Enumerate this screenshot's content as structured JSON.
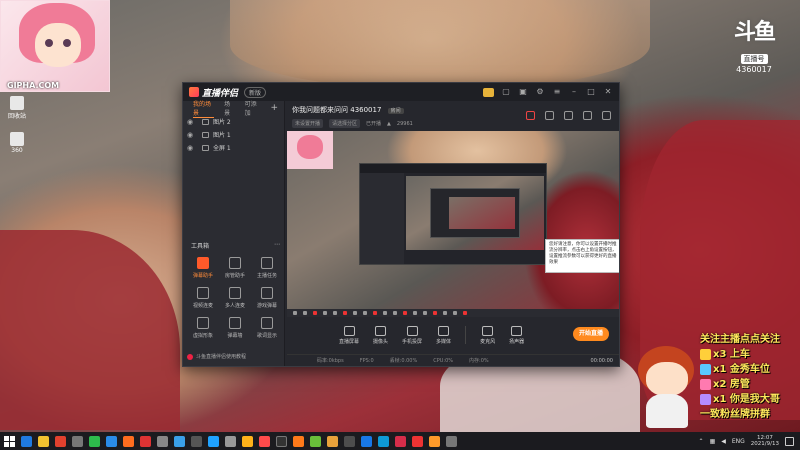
{
  "desktop": {
    "overlay_label": "GIPHA.COM",
    "icons": [
      {
        "label": "回收站"
      },
      {
        "label": "360"
      }
    ]
  },
  "watermark": {
    "logo": "斗鱼",
    "badge": "直播号",
    "room_id": "4360017"
  },
  "app": {
    "brand": "直播伴侣",
    "version": "新版",
    "left_tabs": [
      {
        "label": "我的场景",
        "active": true
      },
      {
        "label": "场景",
        "active": false
      },
      {
        "label": "可添加",
        "active": false
      }
    ],
    "scenes": [
      {
        "label": "图片 2"
      },
      {
        "label": "图片 1"
      },
      {
        "label": "全屏 1"
      }
    ],
    "tools_title": "工具箱",
    "tools": [
      {
        "label": "弹幕助手",
        "hot": true
      },
      {
        "label": "房管助手",
        "hot": false
      },
      {
        "label": "主播任务",
        "hot": false
      },
      {
        "label": "视频连麦",
        "hot": false
      },
      {
        "label": "多人连麦",
        "hot": false
      },
      {
        "label": "游戏弹幕",
        "hot": false
      },
      {
        "label": "虚拟形象",
        "hot": false
      },
      {
        "label": "弹幕墙",
        "hot": false
      },
      {
        "label": "歌词显示",
        "hot": false
      }
    ],
    "footer_text": "斗鱼直播伴侣使用教程",
    "room_title": "你我问题都来问问",
    "room_id": "4360017",
    "room_tag": "房间",
    "room_sub": [
      "未设置开播",
      "请选择分区",
      "已开播"
    ],
    "room_count": "29961",
    "preview_tooltip": "您好请注意，你可以设置开播时推流分辨率，点击右上角设置按钮，设置推流参数可以获得更好的直播效果",
    "bottom_tools": [
      {
        "label": "直播屏幕"
      },
      {
        "label": "摄像头"
      },
      {
        "label": "手机投屏"
      },
      {
        "label": "多媒体"
      },
      {
        "label": "麦克风"
      },
      {
        "label": "扬声器"
      }
    ],
    "go_live": "开始直播",
    "status": [
      "码率:0kbps",
      "FPS:0",
      "丢帧:0.00%",
      "CPU:0%",
      "内存:0%"
    ],
    "status_time": "00:00:00"
  },
  "overlay_list": [
    {
      "text": "关注主播点点关注"
    },
    {
      "text": "x3 上车"
    },
    {
      "text": "x1 金秀车位"
    },
    {
      "text": "x2 房管"
    },
    {
      "text": "x1 你是我大哥"
    },
    {
      "text": "一致粉丝牌拼群"
    }
  ],
  "taskbar": {
    "lang": "ENG",
    "time": "12:07",
    "date": "2021/9/13"
  }
}
